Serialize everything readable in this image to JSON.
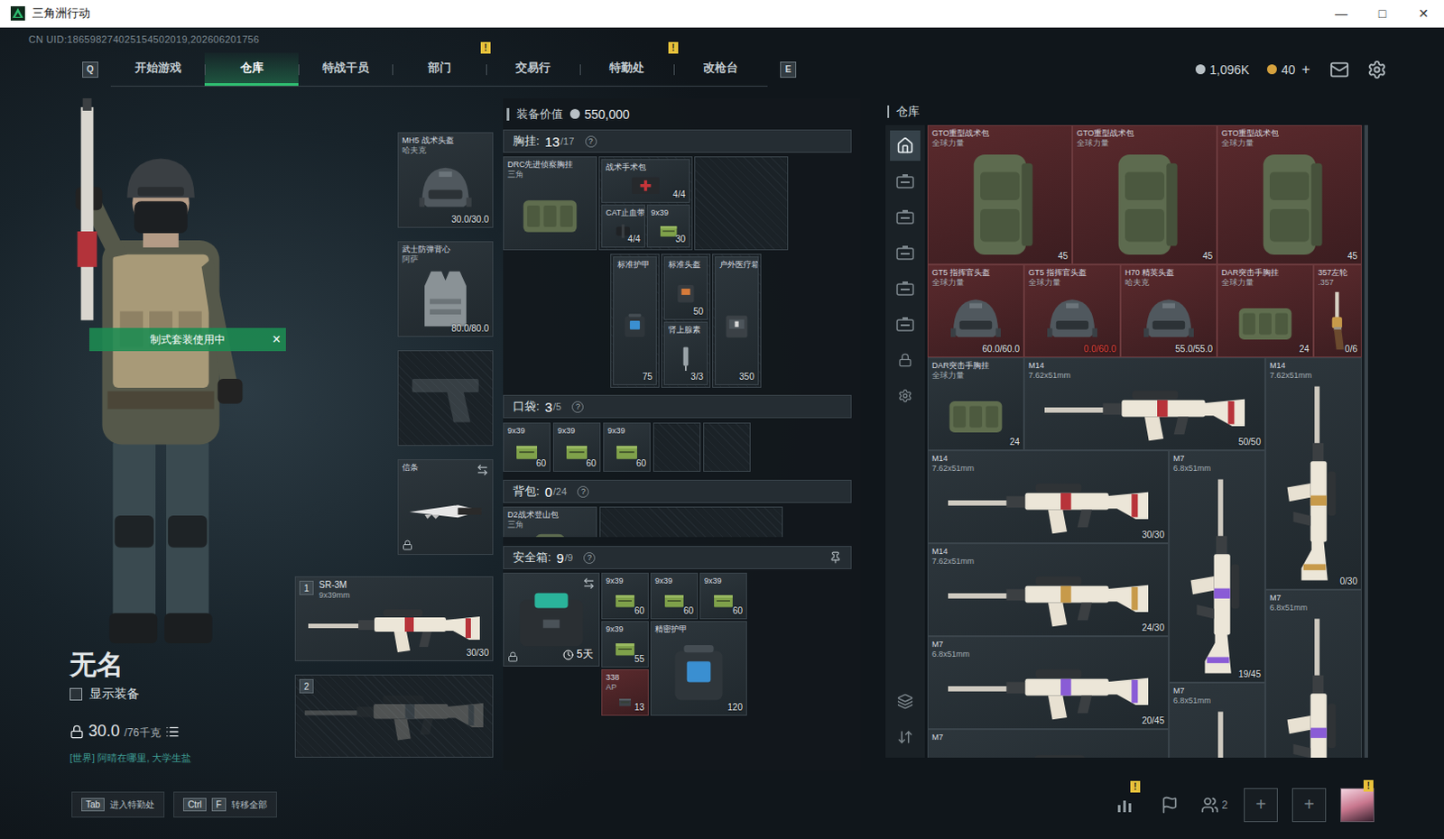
{
  "window": {
    "title": "三角洲行动",
    "controls": [
      "—",
      "□",
      "✕"
    ]
  },
  "uid": "CN UID:186598274025154502019,202606201756",
  "nav": {
    "keys": [
      "Q",
      "E"
    ],
    "alert_mark": "!",
    "tabs": [
      {
        "label": "开始游戏",
        "selected": false,
        "alert": false
      },
      {
        "label": "仓库",
        "selected": true,
        "alert": false
      },
      {
        "label": "特战干员",
        "selected": false,
        "alert": false
      },
      {
        "label": "部门",
        "selected": false,
        "alert": true
      },
      {
        "label": "交易行",
        "selected": false,
        "alert": false
      },
      {
        "label": "特勤处",
        "selected": false,
        "alert": true
      },
      {
        "label": "改枪台",
        "selected": false,
        "alert": false
      }
    ]
  },
  "wallet": {
    "coins": "1,096K",
    "bonds": "40",
    "add": "+"
  },
  "character": {
    "name": "无名",
    "show_gear": {
      "label": "显示装备",
      "checked": false
    },
    "weight": "30.0",
    "weight_max": "/76千克",
    "banner": "制式套装使用中",
    "banner_close": "×",
    "chat": "[世界] 阿晴在哪里, 大学生盐"
  },
  "hotkeys": [
    {
      "keys": [
        "Tab"
      ],
      "label": "进入特勤处"
    },
    {
      "keys": [
        "Ctrl",
        "F"
      ],
      "label": "转移全部"
    }
  ],
  "gear_slots": [
    {
      "kind": "helmet",
      "empty": false,
      "name": "MH5 战术头盔",
      "sub": "哈夫克",
      "value": "30.0/30.0",
      "locked": false,
      "swap": false
    },
    {
      "kind": "vest",
      "empty": false,
      "name": "武士防弹背心",
      "sub": "阿萨",
      "value": "80.0/80.0",
      "locked": false,
      "swap": false
    },
    {
      "kind": "pistol",
      "empty": true,
      "locked": false,
      "swap": false
    },
    {
      "kind": "knife",
      "empty": false,
      "name": "信条",
      "locked": true,
      "swap": true
    }
  ],
  "weapon_slots": [
    {
      "index": "1",
      "empty": false,
      "name": "SR-3M",
      "caliber": "9x39mm",
      "ammo": "30/30",
      "color": "#b8333a"
    },
    {
      "index": "2",
      "empty": true
    }
  ],
  "loadout": {
    "value_label": "装备价值",
    "value": "550,000",
    "chest": {
      "label": "胸挂:",
      "count": "13",
      "capacity": "/17",
      "help": "?",
      "rig": {
        "name": "DRC先进侦察胸挂",
        "sub": "三角"
      },
      "rows": [
        [
          {
            "items": [
              {
                "kind": "medkit",
                "name": "战术手术包",
                "count": "4/4"
              },
              {
                "kind": "tourniquet",
                "name": "CAT止血带",
                "count": "4/4"
              },
              {
                "kind": "ammo",
                "name": "9x39",
                "count": "30"
              }
            ]
          },
          {
            "items": []
          }
        ],
        [
          {
            "items": [
              {
                "kind": "armorkit",
                "name": "标准护甲",
                "count": "75"
              }
            ]
          },
          {
            "items": [
              {
                "kind": "helmetkit",
                "name": "标准头盔",
                "count": "50"
              },
              {
                "kind": "injector",
                "name": "肾上腺素",
                "count": "3/3"
              }
            ]
          },
          {
            "items": [
              {
                "kind": "medbox",
                "name": "户外医疗箱",
                "count": "350"
              }
            ]
          }
        ]
      ]
    },
    "pockets": {
      "label": "口袋:",
      "count": "3",
      "capacity": "/5",
      "help": "?",
      "slots": [
        {
          "empty": false,
          "kind": "ammo",
          "name": "9x39",
          "count": "60"
        },
        {
          "empty": false,
          "kind": "ammo",
          "name": "9x39",
          "count": "60"
        },
        {
          "empty": false,
          "kind": "ammo",
          "name": "9x39",
          "count": "60"
        },
        {
          "empty": true
        },
        {
          "empty": true
        }
      ]
    },
    "backpack": {
      "label": "背包:",
      "count": "0",
      "capacity": "/24",
      "help": "?",
      "bag": {
        "name": "D2战术登山包",
        "sub": "三角"
      }
    },
    "safe": {
      "label": "安全箱:",
      "count": "9",
      "capacity": "/9",
      "help": "?",
      "case": {
        "timer": "5天",
        "locked": true,
        "swap": true
      },
      "items": [
        {
          "kind": "ammo",
          "name": "9x39",
          "count": "60"
        },
        {
          "kind": "ammo",
          "name": "9x39",
          "count": "60"
        },
        {
          "kind": "ammo",
          "name": "9x39",
          "count": "60"
        },
        {
          "kind": "ammo",
          "name": "9x39",
          "count": "55"
        },
        {
          "kind": "armorkit",
          "name": "精密护甲",
          "count": "120"
        },
        {
          "kind": "ammoap",
          "name": "338",
          "sub": "AP",
          "count": "13"
        }
      ]
    }
  },
  "warehouse": {
    "title": "仓库",
    "sidebar": [
      {
        "kind": "home",
        "selected": true
      },
      {
        "kind": "case",
        "selected": false
      },
      {
        "kind": "case",
        "selected": false
      },
      {
        "kind": "case",
        "selected": false
      },
      {
        "kind": "case",
        "selected": false
      },
      {
        "kind": "case",
        "selected": false
      },
      {
        "kind": "lock",
        "selected": false
      },
      {
        "kind": "gear",
        "selected": false
      },
      {
        "kind": "layers",
        "selected": false
      },
      {
        "kind": "sort",
        "selected": false
      }
    ],
    "items": [
      {
        "kind": "bag",
        "name": "GTO重型战术包",
        "sub": "全球力量",
        "value": "45",
        "highlighted": true,
        "broken": false
      },
      {
        "kind": "bag",
        "name": "GTO重型战术包",
        "sub": "全球力量",
        "value": "45",
        "highlighted": true,
        "broken": false
      },
      {
        "kind": "bag",
        "name": "GTO重型战术包",
        "sub": "全球力量",
        "value": "45",
        "highlighted": true,
        "broken": false
      },
      {
        "kind": "helmet",
        "name": "GT5 指挥官头盔",
        "sub": "全球力量",
        "value": "60.0/60.0",
        "highlighted": true,
        "broken": false
      },
      {
        "kind": "helmet",
        "name": "GT5 指挥官头盔",
        "sub": "全球力量",
        "value": "0.0/60.0",
        "highlighted": true,
        "broken": true
      },
      {
        "kind": "helmet",
        "name": "H70 精英头盔",
        "sub": "哈夫克",
        "value": "55.0/55.0",
        "highlighted": true,
        "broken": false
      },
      {
        "kind": "rig",
        "name": "DAR突击手胸挂",
        "sub": "全球力量",
        "value": "24",
        "highlighted": true,
        "broken": false
      },
      {
        "kind": "pistol",
        "name": "357左轮",
        "sub": ".357",
        "value": "0/6",
        "highlighted": true,
        "broken": false,
        "color": "#c79a4a"
      },
      {
        "kind": "rig",
        "name": "DAR突击手胸挂",
        "sub": "全球力量",
        "value": "24",
        "highlighted": false,
        "broken": false
      },
      {
        "kind": "rifle",
        "name": "M14",
        "sub": "7.62x51mm",
        "value": "50/50",
        "highlighted": false,
        "broken": false,
        "color": "#b8333a"
      },
      {
        "kind": "uprifle",
        "name": "M14",
        "sub": "7.62x51mm",
        "value": "0/30",
        "highlighted": false,
        "broken": false,
        "color": "#c79a4a"
      },
      {
        "kind": "rifle",
        "name": "M14",
        "sub": "7.62x51mm",
        "value": "30/30",
        "highlighted": false,
        "broken": false,
        "color": "#b8333a"
      },
      {
        "kind": "uprifle",
        "name": "M7",
        "sub": "6.8x51mm",
        "value": "19/45",
        "highlighted": false,
        "broken": false,
        "color": "#8a5cd6"
      },
      {
        "kind": "rifle",
        "name": "M14",
        "sub": "7.62x51mm",
        "value": "24/30",
        "highlighted": false,
        "broken": false,
        "color": "#c79a4a"
      },
      {
        "kind": "uprifle",
        "name": "M7",
        "sub": "6.8x51mm",
        "highlighted": false,
        "broken": false,
        "color": "#8a5cd6"
      },
      {
        "kind": "rifle",
        "name": "M7",
        "sub": "6.8x51mm",
        "value": "20/45",
        "highlighted": false,
        "broken": false,
        "color": "#8a5cd6"
      },
      {
        "kind": "uprifle",
        "name": "M7",
        "sub": "6.8x51mm",
        "highlighted": false,
        "broken": false,
        "color": "#8a5cd6"
      },
      {
        "kind": "rifle",
        "name": "M7",
        "highlighted": false,
        "broken": false,
        "color": "#8a5cd6"
      }
    ]
  },
  "bottom_bar": {
    "buttons": [
      {
        "kind": "stats",
        "alert": true
      },
      {
        "kind": "flag",
        "alert": false
      },
      {
        "kind": "friends",
        "alert": false,
        "count": "2"
      }
    ],
    "party_slots": [
      "+",
      "+"
    ],
    "avatar": {
      "alert": true
    }
  }
}
